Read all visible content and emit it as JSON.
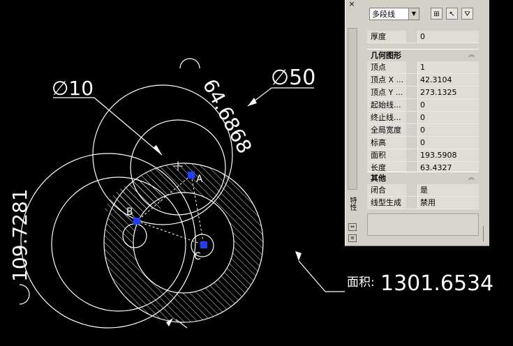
{
  "drawing": {
    "dim_diameter_10": "∅10",
    "dim_diameter_50": "∅50",
    "dim_arc_64": "64.6868",
    "dim_arc_109": "109.7281",
    "point_a": "A",
    "point_b": "B",
    "point_c": "C",
    "area_label": "面积:",
    "area_value": "1301.6534"
  },
  "palette": {
    "object_type": "多段线",
    "side_title": "特性",
    "general_rows": [
      {
        "name": "厚度",
        "value": "0"
      }
    ],
    "geometry_header": "几何图形",
    "geometry_rows": [
      {
        "name": "顶点",
        "value": "1"
      },
      {
        "name": "顶点 X ...",
        "value": "42.3104"
      },
      {
        "name": "顶点 Y ...",
        "value": "273.1325"
      },
      {
        "name": "起始线...",
        "value": "0"
      },
      {
        "name": "终止线...",
        "value": "0"
      },
      {
        "name": "全局宽度",
        "value": "0"
      },
      {
        "name": "标高",
        "value": "0"
      },
      {
        "name": "面积",
        "value": "193.5908"
      },
      {
        "name": "长度",
        "value": "63.4327"
      }
    ],
    "misc_header": "其他",
    "misc_rows": [
      {
        "name": "闭合",
        "value": "是"
      },
      {
        "name": "线型生成",
        "value": "禁用"
      }
    ]
  },
  "colors": {
    "canvas": "#000000",
    "lines": "#ffffff",
    "grip": "#1f3fff",
    "palette_bg": "#d4d0c8"
  }
}
